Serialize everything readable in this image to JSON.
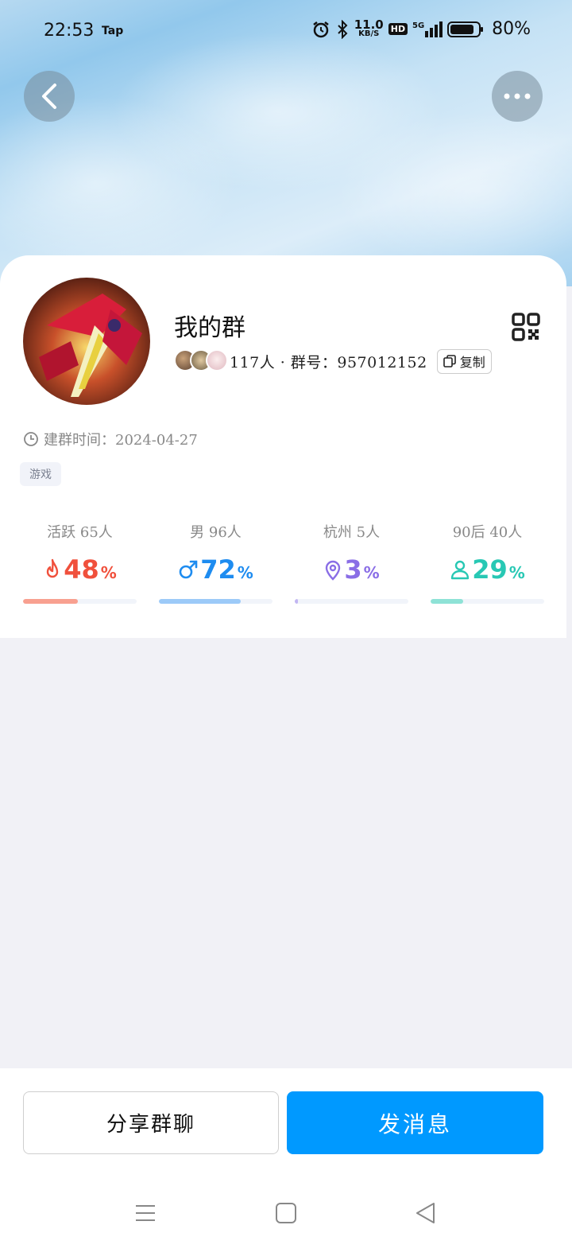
{
  "status_bar": {
    "time": "22:53",
    "app_indicator": "Tap",
    "network_speed_value": "11.0",
    "network_speed_unit": "KB/S",
    "hd_badge": "HD",
    "signal_label": "5G",
    "battery_percent": "80%"
  },
  "header": {
    "back_icon": "chevron-left-icon",
    "more_icon": "more-dots-icon"
  },
  "group": {
    "name": "我的群",
    "member_info": "117人 · 群号：957012152",
    "copy_label": "复制",
    "created_label": "建群时间：2024-04-27",
    "tag": "游戏"
  },
  "stats": [
    {
      "label": "活跃 65人",
      "value": "48",
      "unit": "%",
      "ratio": 0.48,
      "color": "#f0503c",
      "track_color": "#f8a090",
      "icon": "flame-icon"
    },
    {
      "label": "男 96人",
      "value": "72",
      "unit": "%",
      "ratio": 0.72,
      "color": "#1e8cf0",
      "track_color": "#9ccaf8",
      "icon": "male-icon"
    },
    {
      "label": "杭州 5人",
      "value": "3",
      "unit": "%",
      "ratio": 0.03,
      "color": "#8a6ee6",
      "track_color": "#c2b6f2",
      "icon": "location-pin-icon"
    },
    {
      "label": "90后 40人",
      "value": "29",
      "unit": "%",
      "ratio": 0.29,
      "color": "#28c8b4",
      "track_color": "#8ee2d6",
      "icon": "person-icon"
    }
  ],
  "actions": {
    "share_label": "分享群聊",
    "send_label": "发消息"
  },
  "colors": {
    "primary": "#0099ff",
    "background": "#f1f1f6"
  }
}
